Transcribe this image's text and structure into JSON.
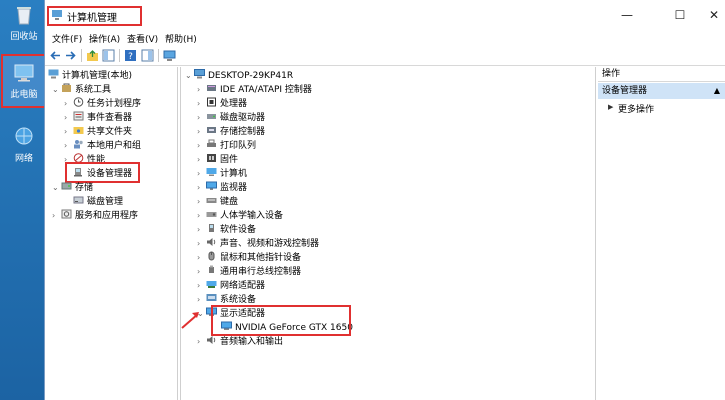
{
  "desktop": {
    "icons": [
      {
        "label": "回收站"
      },
      {
        "label": "此电脑"
      },
      {
        "label": "网络"
      }
    ]
  },
  "window": {
    "title": "计算机管理",
    "menus": [
      "文件(F)",
      "操作(A)",
      "查看(V)",
      "帮助(H)"
    ],
    "controls": {
      "minimize": "—",
      "maximize": "☐",
      "close": "✕"
    }
  },
  "left_tree": [
    {
      "label": "计算机管理(本地)"
    },
    {
      "label": "系统工具"
    },
    {
      "label": "任务计划程序"
    },
    {
      "label": "事件查看器"
    },
    {
      "label": "共享文件夹"
    },
    {
      "label": "本地用户和组"
    },
    {
      "label": "性能"
    },
    {
      "label": "设备管理器"
    },
    {
      "label": "存储"
    },
    {
      "label": "磁盘管理"
    },
    {
      "label": "服务和应用程序"
    }
  ],
  "device_tree": {
    "root": "DESKTOP-29KP41R",
    "items": [
      "IDE ATA/ATAPI 控制器",
      "处理器",
      "磁盘驱动器",
      "存储控制器",
      "打印队列",
      "固件",
      "计算机",
      "监视器",
      "键盘",
      "人体学输入设备",
      "软件设备",
      "声音、视频和游戏控制器",
      "鼠标和其他指针设备",
      "通用串行总线控制器",
      "网络适配器",
      "系统设备",
      "显示适配器",
      "NVIDIA GeForce GTX 1650",
      "音频输入和输出"
    ]
  },
  "actions": {
    "header": "操作",
    "selected": "设备管理器",
    "more": "更多操作"
  }
}
